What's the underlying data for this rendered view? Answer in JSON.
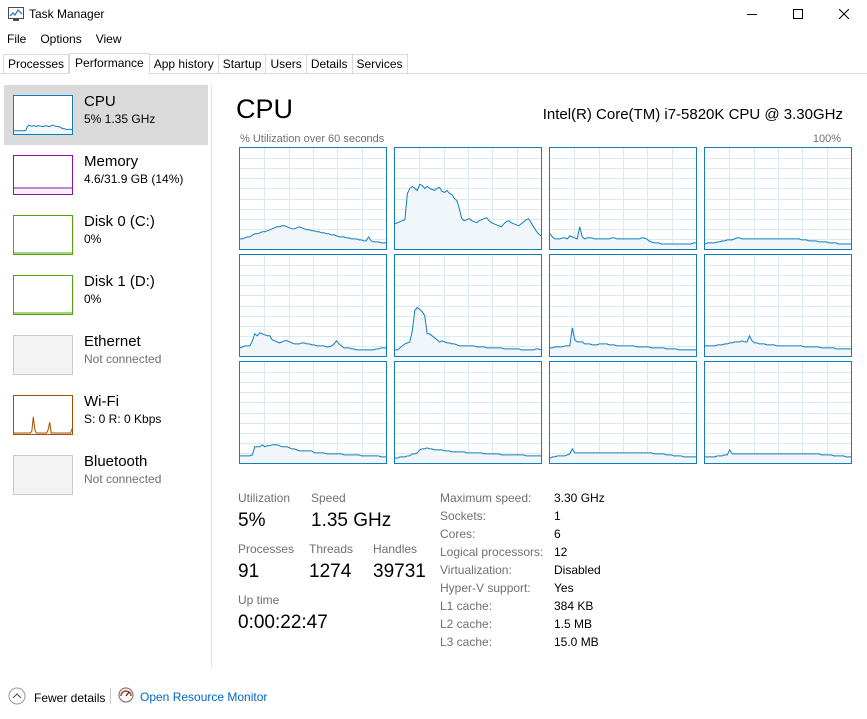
{
  "window": {
    "title": "Task Manager",
    "minimize_icon": "minimize-icon",
    "maximize_icon": "maximize-icon",
    "close_icon": "close-icon"
  },
  "menu": [
    "File",
    "Options",
    "View"
  ],
  "tabs": [
    "Processes",
    "Performance",
    "App history",
    "Startup",
    "Users",
    "Details",
    "Services"
  ],
  "active_tab": "Performance",
  "sidebar": [
    {
      "name": "CPU",
      "sub": "5%  1.35 GHz",
      "color": "#117dbb",
      "selected": true
    },
    {
      "name": "Memory",
      "sub": "4.6/31.9 GB (14%)",
      "color": "#8b12ae"
    },
    {
      "name": "Disk 0 (C:)",
      "sub": "0%",
      "color": "#4da60c"
    },
    {
      "name": "Disk 1 (D:)",
      "sub": "0%",
      "color": "#4da60c"
    },
    {
      "name": "Ethernet",
      "sub": "Not connected",
      "color": "#c9c9c9",
      "disabled": true
    },
    {
      "name": "Wi-Fi",
      "sub": "S: 0  R: 0 Kbps",
      "color": "#a74f01"
    },
    {
      "name": "Bluetooth",
      "sub": "Not connected",
      "color": "#c9c9c9",
      "disabled": true
    }
  ],
  "main": {
    "title": "CPU",
    "model": "Intel(R) Core(TM) i7-5820K CPU @ 3.30GHz",
    "graph_label": "% Utilization over 60 seconds",
    "graph_max": "100%"
  },
  "stats": {
    "utilization_label": "Utilization",
    "utilization": "5%",
    "speed_label": "Speed",
    "speed": "1.35 GHz",
    "processes_label": "Processes",
    "processes": "91",
    "threads_label": "Threads",
    "threads": "1274",
    "handles_label": "Handles",
    "handles": "39731",
    "uptime_label": "Up time",
    "uptime": "0:00:22:47"
  },
  "details": [
    {
      "key": "Maximum speed:",
      "value": "3.30 GHz"
    },
    {
      "key": "Sockets:",
      "value": "1"
    },
    {
      "key": "Cores:",
      "value": "6"
    },
    {
      "key": "Logical processors:",
      "value": "12"
    },
    {
      "key": "Virtualization:",
      "value": "Disabled"
    },
    {
      "key": "Hyper-V support:",
      "value": "Yes"
    },
    {
      "key": "L1 cache:",
      "value": "384 KB"
    },
    {
      "key": "L2 cache:",
      "value": "1.5 MB"
    },
    {
      "key": "L3 cache:",
      "value": "15.0 MB"
    }
  ],
  "footer": {
    "fewer_details": "Fewer details",
    "resource_monitor": "Open Resource Monitor"
  },
  "colors": {
    "cpu_line": "#117dbb",
    "cpu_fill": "#f1f6fa",
    "grid": "#d9eaf4"
  },
  "core_utilization": [
    [
      10,
      10,
      11,
      12,
      12,
      14,
      15,
      15,
      16,
      17,
      17,
      18,
      19,
      20,
      21,
      22,
      22,
      23,
      23,
      22,
      21,
      20,
      20,
      21,
      22,
      21,
      20,
      19,
      19,
      18,
      18,
      17,
      17,
      16,
      16,
      15,
      15,
      14,
      14,
      13,
      12,
      12,
      12,
      11,
      11,
      10,
      10,
      10,
      9,
      9,
      8,
      8,
      12,
      8,
      7,
      7,
      7,
      6,
      6,
      6
    ],
    [
      25,
      26,
      27,
      28,
      29,
      55,
      60,
      62,
      60,
      58,
      64,
      63,
      60,
      62,
      60,
      59,
      58,
      60,
      61,
      57,
      56,
      58,
      55,
      54,
      50,
      48,
      40,
      30,
      28,
      29,
      30,
      28,
      27,
      26,
      28,
      29,
      30,
      31,
      28,
      26,
      25,
      24,
      23,
      22,
      25,
      27,
      28,
      26,
      25,
      24,
      23,
      25,
      27,
      29,
      30,
      26,
      22,
      18,
      15,
      13
    ],
    [
      15,
      12,
      10,
      10,
      10,
      11,
      11,
      10,
      13,
      12,
      11,
      10,
      22,
      12,
      10,
      11,
      11,
      11,
      10,
      10,
      10,
      10,
      10,
      10,
      10,
      11,
      11,
      10,
      10,
      10,
      10,
      10,
      10,
      10,
      10,
      10,
      10,
      11,
      11,
      10,
      8,
      7,
      6,
      6,
      6,
      5,
      5,
      5,
      5,
      5,
      5,
      5,
      5,
      5,
      5,
      5,
      5,
      5,
      6,
      6
    ],
    [
      5,
      6,
      6,
      6,
      6,
      7,
      7,
      8,
      8,
      9,
      9,
      9,
      10,
      11,
      11,
      10,
      10,
      10,
      10,
      10,
      10,
      10,
      10,
      10,
      10,
      10,
      10,
      10,
      10,
      10,
      10,
      10,
      10,
      10,
      10,
      10,
      10,
      10,
      10,
      9,
      9,
      9,
      8,
      8,
      8,
      8,
      7,
      7,
      7,
      7,
      6,
      6,
      6,
      6,
      5,
      5,
      5,
      5,
      5,
      5
    ],
    [
      8,
      9,
      10,
      10,
      10,
      15,
      22,
      20,
      23,
      22,
      21,
      20,
      20,
      16,
      15,
      14,
      13,
      14,
      15,
      15,
      14,
      13,
      12,
      12,
      12,
      13,
      13,
      12,
      12,
      11,
      11,
      10,
      10,
      10,
      10,
      9,
      9,
      10,
      12,
      15,
      12,
      10,
      8,
      8,
      8,
      7,
      7,
      6,
      6,
      6,
      6,
      6,
      6,
      6,
      6,
      7,
      7,
      8,
      8,
      8
    ],
    [
      6,
      6,
      8,
      10,
      12,
      13,
      14,
      25,
      45,
      48,
      46,
      44,
      40,
      22,
      22,
      20,
      18,
      16,
      14,
      15,
      14,
      13,
      13,
      12,
      12,
      11,
      10,
      10,
      10,
      10,
      10,
      10,
      10,
      9,
      9,
      9,
      9,
      8,
      8,
      8,
      8,
      8,
      8,
      8,
      7,
      7,
      7,
      7,
      7,
      7,
      7,
      6,
      6,
      6,
      6,
      6,
      6,
      7,
      7,
      6
    ],
    [
      8,
      8,
      9,
      9,
      9,
      9,
      10,
      10,
      10,
      28,
      16,
      14,
      14,
      14,
      12,
      12,
      12,
      11,
      11,
      11,
      12,
      12,
      12,
      12,
      11,
      11,
      11,
      10,
      10,
      10,
      10,
      10,
      10,
      10,
      10,
      9,
      9,
      9,
      9,
      9,
      9,
      8,
      8,
      8,
      8,
      8,
      8,
      7,
      7,
      7,
      7,
      7,
      6,
      6,
      6,
      6,
      6,
      6,
      6,
      6
    ],
    [
      10,
      10,
      10,
      10,
      10,
      11,
      11,
      11,
      12,
      12,
      13,
      13,
      14,
      14,
      14,
      15,
      14,
      14,
      20,
      15,
      13,
      13,
      12,
      12,
      12,
      11,
      11,
      11,
      11,
      10,
      10,
      10,
      10,
      10,
      10,
      10,
      10,
      10,
      10,
      10,
      9,
      9,
      9,
      9,
      9,
      9,
      9,
      8,
      8,
      8,
      8,
      8,
      8,
      7,
      7,
      7,
      7,
      7,
      7,
      7
    ],
    [
      7,
      7,
      7,
      7,
      7,
      8,
      16,
      16,
      16,
      18,
      16,
      17,
      17,
      18,
      18,
      18,
      17,
      16,
      16,
      16,
      15,
      14,
      14,
      13,
      12,
      12,
      12,
      12,
      12,
      12,
      10,
      10,
      10,
      10,
      10,
      9,
      9,
      9,
      9,
      9,
      9,
      9,
      8,
      8,
      8,
      8,
      8,
      8,
      8,
      7,
      7,
      7,
      7,
      7,
      7,
      7,
      7,
      6,
      6,
      6
    ],
    [
      5,
      5,
      6,
      6,
      6,
      7,
      7,
      9,
      9,
      10,
      13,
      14,
      14,
      15,
      14,
      14,
      13,
      13,
      13,
      13,
      12,
      12,
      12,
      11,
      11,
      11,
      11,
      11,
      11,
      10,
      10,
      10,
      10,
      10,
      10,
      10,
      9,
      9,
      9,
      9,
      9,
      9,
      9,
      8,
      8,
      8,
      8,
      8,
      8,
      8,
      8,
      8,
      8,
      7,
      7,
      7,
      7,
      7,
      7,
      7
    ],
    [
      5,
      6,
      6,
      7,
      7,
      7,
      7,
      8,
      9,
      14,
      10,
      10,
      10,
      10,
      10,
      10,
      10,
      10,
      10,
      10,
      10,
      10,
      10,
      10,
      10,
      10,
      10,
      10,
      10,
      10,
      10,
      10,
      10,
      10,
      10,
      10,
      10,
      10,
      10,
      10,
      10,
      10,
      9,
      9,
      9,
      9,
      9,
      8,
      8,
      8,
      7,
      7,
      7,
      7,
      6,
      6,
      6,
      6,
      6,
      6
    ],
    [
      6,
      6,
      6,
      6,
      6,
      7,
      7,
      7,
      8,
      8,
      13,
      9,
      9,
      9,
      9,
      9,
      9,
      9,
      9,
      9,
      9,
      9,
      9,
      9,
      9,
      9,
      9,
      9,
      9,
      9,
      9,
      9,
      9,
      9,
      9,
      9,
      9,
      9,
      9,
      9,
      9,
      9,
      9,
      9,
      9,
      9,
      9,
      8,
      8,
      8,
      8,
      8,
      7,
      7,
      7,
      7,
      7,
      6,
      6,
      6
    ]
  ],
  "sidebar_history": {
    "cpu": [
      6,
      6,
      6,
      6,
      6,
      6,
      6,
      6,
      8,
      18,
      22,
      20,
      19,
      20,
      20,
      18,
      20,
      20,
      19,
      18,
      18,
      20,
      20,
      18,
      18,
      20,
      22,
      20,
      19,
      18,
      18,
      16,
      14,
      12,
      12,
      10,
      10,
      10,
      10,
      10
    ],
    "memory": [
      14,
      14,
      14,
      14,
      14,
      14,
      14,
      14,
      14,
      14,
      14,
      14,
      14,
      14,
      14,
      14,
      14,
      14,
      14,
      14,
      14,
      14,
      14,
      14,
      14,
      14,
      14,
      14,
      14,
      14,
      14,
      14,
      14,
      14,
      14,
      14,
      14,
      14,
      14,
      14
    ],
    "disk0": [
      0,
      0,
      0,
      0,
      0,
      0,
      0,
      0,
      0,
      0,
      0,
      0,
      0,
      0,
      0,
      0,
      0,
      0,
      0,
      0,
      0,
      0,
      0,
      0,
      0,
      0,
      0,
      0,
      0,
      0,
      0,
      0,
      0,
      0,
      0,
      0,
      0,
      0,
      0,
      0
    ],
    "disk1": [
      0,
      0,
      0,
      0,
      0,
      0,
      0,
      0,
      0,
      0,
      0,
      0,
      0,
      0,
      0,
      0,
      0,
      0,
      0,
      0,
      0,
      0,
      0,
      0,
      0,
      0,
      0,
      0,
      0,
      0,
      0,
      0,
      0,
      0,
      0,
      0,
      0,
      0,
      0,
      0
    ],
    "wifi": [
      0,
      0,
      0,
      0,
      0,
      0,
      0,
      0,
      0,
      0,
      0,
      0,
      5,
      45,
      10,
      0,
      0,
      0,
      0,
      0,
      0,
      0,
      0,
      10,
      30,
      0,
      0,
      0,
      0,
      0,
      0,
      0,
      0,
      0,
      0,
      0,
      0,
      0,
      0,
      12
    ]
  }
}
